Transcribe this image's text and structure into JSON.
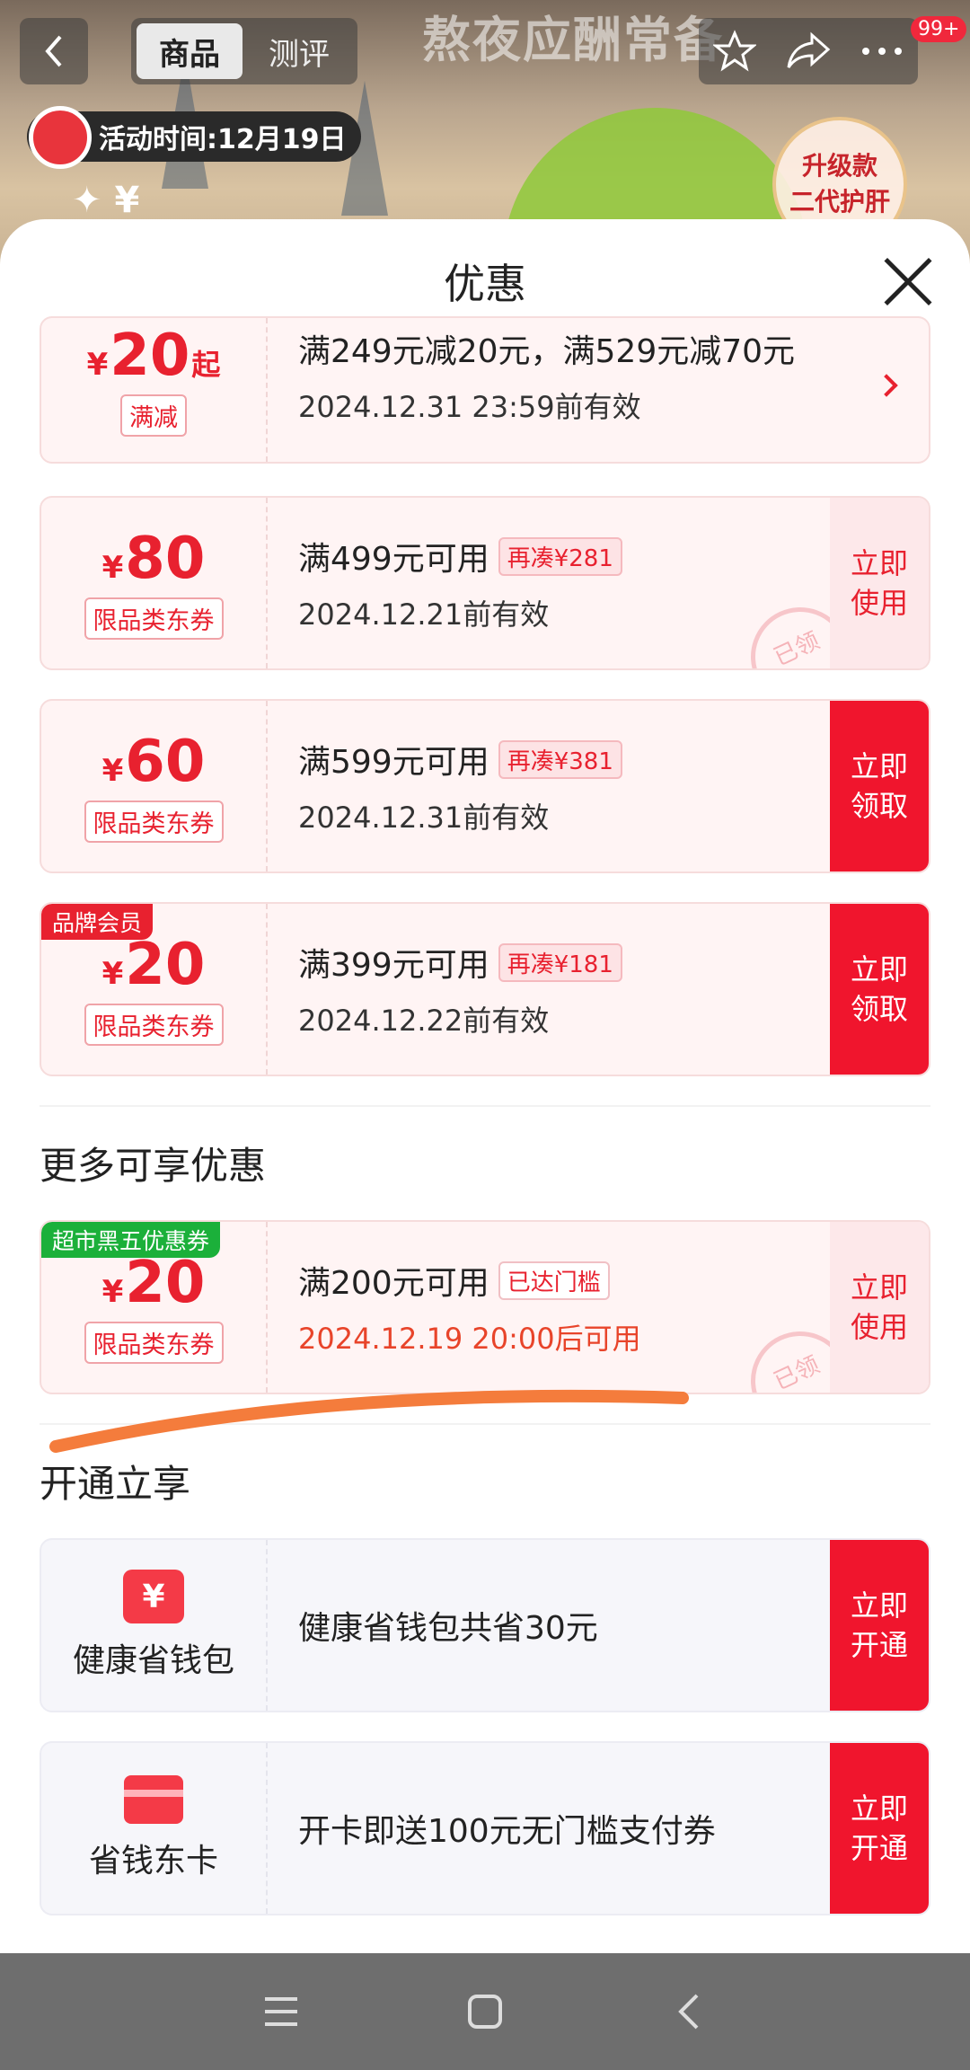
{
  "background": {
    "header_deco_text": "熬夜应酬常备",
    "tabs": [
      {
        "label": "商品",
        "active": true
      },
      {
        "label": "测评",
        "active": false
      }
    ],
    "message_badge": "99+",
    "promo_time": "活动时间:12月19日",
    "price_peek": "✦ ¥",
    "round_badge": [
      "升级款",
      "二代护肝"
    ]
  },
  "sheet": {
    "title": "优惠",
    "coupons": [
      {
        "amount": "20",
        "suffix": "起",
        "type": "满减",
        "condition": "满249元减20元，满529元减70元",
        "validity": "2024.12.31 23:59前有效",
        "action": "arrow"
      },
      {
        "amount": "80",
        "type": "限品类东券",
        "condition": "满499元可用",
        "chip": "再凑¥281",
        "validity": "2024.12.21前有效",
        "action": [
          "立即",
          "使用"
        ],
        "stamp": "已领"
      },
      {
        "amount": "60",
        "type": "限品类东券",
        "condition": "满599元可用",
        "chip": "再凑¥381",
        "validity": "2024.12.31前有效",
        "action": [
          "立即",
          "领取"
        ]
      },
      {
        "amount": "20",
        "type": "限品类东券",
        "corner": "品牌会员",
        "condition": "满399元可用",
        "chip": "再凑¥181",
        "validity": "2024.12.22前有效",
        "action": [
          "立即",
          "领取"
        ]
      }
    ],
    "more_title": "更多可享优惠",
    "more_coupon": {
      "amount": "20",
      "type": "限品类东券",
      "corner": "超市黑五优惠券",
      "condition": "满200元可用",
      "chip": "已达门槛",
      "validity": "2024.12.19 20:00后可用",
      "action": [
        "立即",
        "使用"
      ],
      "stamp": "已领"
    },
    "open_title": "开通立享",
    "services": [
      {
        "icon": "yen-wallet-icon",
        "icon_text": "¥",
        "name": "健康省钱包",
        "desc": "健康省钱包共省30元",
        "action": [
          "立即",
          "开通"
        ]
      },
      {
        "icon": "card-icon",
        "name": "省钱东卡",
        "desc": "开卡即送100元无门槛支付券",
        "action": [
          "立即",
          "开通"
        ]
      }
    ]
  },
  "colors": {
    "accent": "#f0152d",
    "coupon_bg": "#fff4f4",
    "highlight_stroke": "#f47c3c"
  }
}
